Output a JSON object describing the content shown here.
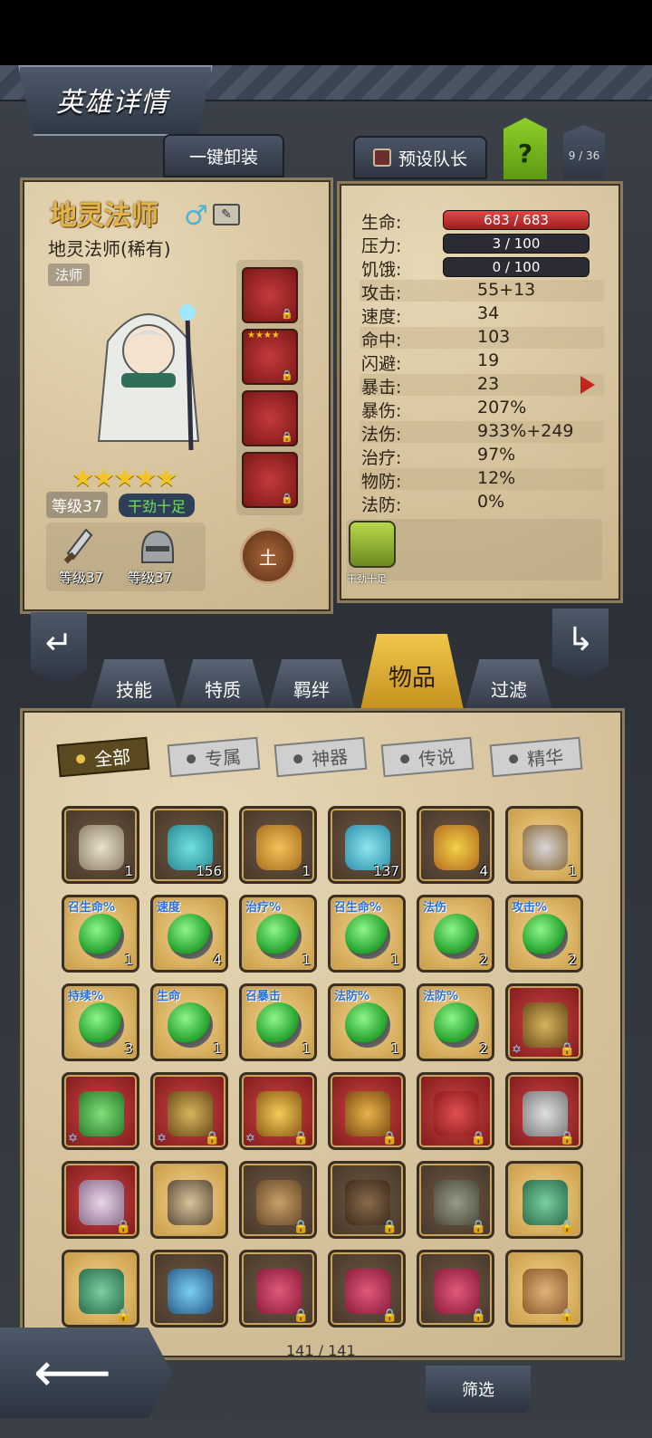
{
  "header": {
    "title": "英雄详情",
    "unequip_all": "一键卸装",
    "preset_captain": "预设队长",
    "help": "?",
    "hero_index": "9 / 36"
  },
  "hero": {
    "name": "地灵法师",
    "subtitle": "地灵法师(稀有)",
    "class_tag": "法师",
    "stars": "★★★★★",
    "level": "等级37",
    "mood": "干劲十足",
    "weapon_level": "等级37",
    "armor_level": "等级37",
    "element": "土",
    "equip_slot2_stars": "★★★★"
  },
  "stats": {
    "hp_label": "生命:",
    "hp_value": "683 / 683",
    "stress_label": "压力:",
    "stress_value": "3 / 100",
    "hunger_label": "饥饿:",
    "hunger_value": "0 / 100",
    "rows": [
      {
        "label": "攻击:",
        "value": "55+13"
      },
      {
        "label": "速度:",
        "value": "34"
      },
      {
        "label": "命中:",
        "value": "103"
      },
      {
        "label": "闪避:",
        "value": "19"
      },
      {
        "label": "暴击:",
        "value": "23"
      },
      {
        "label": "暴伤:",
        "value": "207%"
      },
      {
        "label": "法伤:",
        "value": "933%+249"
      },
      {
        "label": "治疗:",
        "value": "97%"
      },
      {
        "label": "物防:",
        "value": "12%"
      },
      {
        "label": "法防:",
        "value": "0%"
      }
    ],
    "trait_label": "干劲十足"
  },
  "tabs": [
    "技能",
    "特质",
    "羁绊",
    "物品",
    "过滤"
  ],
  "filters": [
    "全部",
    "专属",
    "神器",
    "传说",
    "精华"
  ],
  "items": [
    {
      "count": "1"
    },
    {
      "count": "156"
    },
    {
      "count": "1"
    },
    {
      "count": "137"
    },
    {
      "count": "4"
    },
    {
      "count": "1"
    },
    {
      "tag": "召生命%",
      "count": "1"
    },
    {
      "tag": "速度",
      "count": "4"
    },
    {
      "tag": "治疗%",
      "count": "1"
    },
    {
      "tag": "召生命%",
      "count": "1"
    },
    {
      "tag": "法伤",
      "count": "2"
    },
    {
      "tag": "攻击%",
      "count": "2"
    },
    {
      "tag": "持续%",
      "count": "3"
    },
    {
      "tag": "生命",
      "count": "1"
    },
    {
      "tag": "召暴击",
      "count": "1"
    },
    {
      "tag": "法防%",
      "count": "1"
    },
    {
      "tag": "法防%",
      "count": "2"
    }
  ],
  "footer": {
    "count": "141 / 141",
    "filter": "筛选"
  }
}
